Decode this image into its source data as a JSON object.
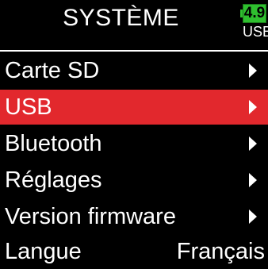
{
  "header": {
    "title": "SYSTÈME",
    "battery": {
      "voltage": "4.9",
      "source": "USB",
      "color": "#2fbf2f"
    }
  },
  "menu": {
    "selected_color": "#e2282d",
    "items": [
      {
        "label": "Carte SD",
        "icon": "chevron-right-icon"
      },
      {
        "label": "USB",
        "icon": "chevron-right-icon",
        "selected": true
      },
      {
        "label": "Bluetooth",
        "icon": "chevron-right-icon"
      },
      {
        "label": "Réglages",
        "icon": "chevron-right-icon"
      },
      {
        "label": "Version firmware",
        "icon": "chevron-right-icon"
      },
      {
        "label": "Langue",
        "value": "Français"
      }
    ]
  }
}
